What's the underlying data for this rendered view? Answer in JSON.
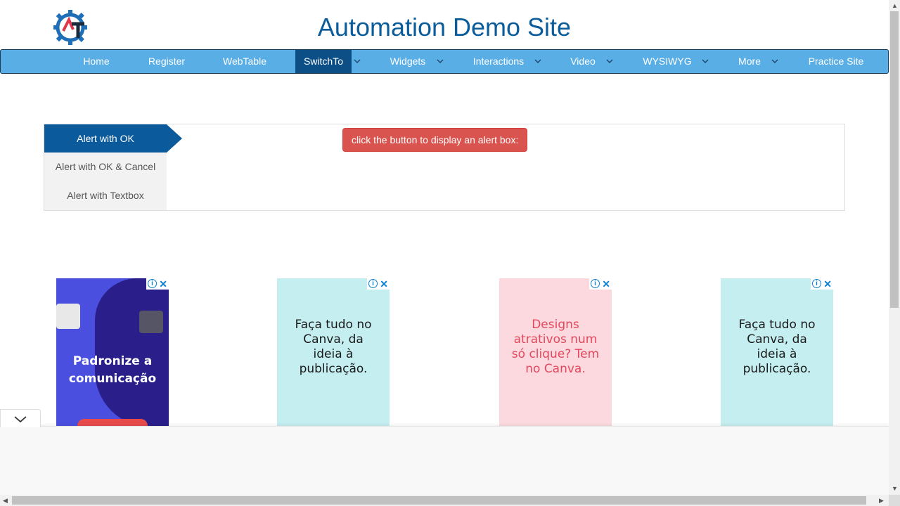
{
  "header": {
    "title": "Automation Demo Site",
    "logo_letters": "AT"
  },
  "navbar": {
    "items": [
      {
        "label": "Home",
        "has_dropdown": false
      },
      {
        "label": "Register",
        "has_dropdown": false
      },
      {
        "label": "WebTable",
        "has_dropdown": false
      },
      {
        "label": "SwitchTo",
        "has_dropdown": true,
        "active": true
      },
      {
        "label": "Widgets",
        "has_dropdown": true
      },
      {
        "label": "Interactions",
        "has_dropdown": true
      },
      {
        "label": "Video",
        "has_dropdown": true
      },
      {
        "label": "WYSIWYG",
        "has_dropdown": true
      },
      {
        "label": "More",
        "has_dropdown": true
      },
      {
        "label": "Practice Site",
        "has_dropdown": false
      }
    ]
  },
  "alerts": {
    "tabs": [
      {
        "label": "Alert with OK",
        "active": true
      },
      {
        "label": "Alert with OK & Cancel"
      },
      {
        "label": "Alert with Textbox"
      }
    ],
    "button_label": "click the button to display an alert box:"
  },
  "ads": [
    {
      "text": "Padronize a comunicação",
      "bg": "#4a4fe0"
    },
    {
      "text": "Faça tudo no Canva, da ideia à publicação.",
      "bg": "#c4eef0"
    },
    {
      "text": "Designs atrativos num só clique? Tem no Canva.",
      "bg": "#fbd9de"
    },
    {
      "text": "Faça tudo no Canva, da ideia à publicação.",
      "bg": "#c4eef0"
    }
  ],
  "ad_controls": {
    "info_icon": "i",
    "close_icon": "✕"
  },
  "colors": {
    "navbar": "#5aaee6",
    "nav_active": "#0b4f86",
    "title": "#0a5c9a",
    "alert_button": "#d9534f",
    "tab_active": "#0b5a9b"
  }
}
